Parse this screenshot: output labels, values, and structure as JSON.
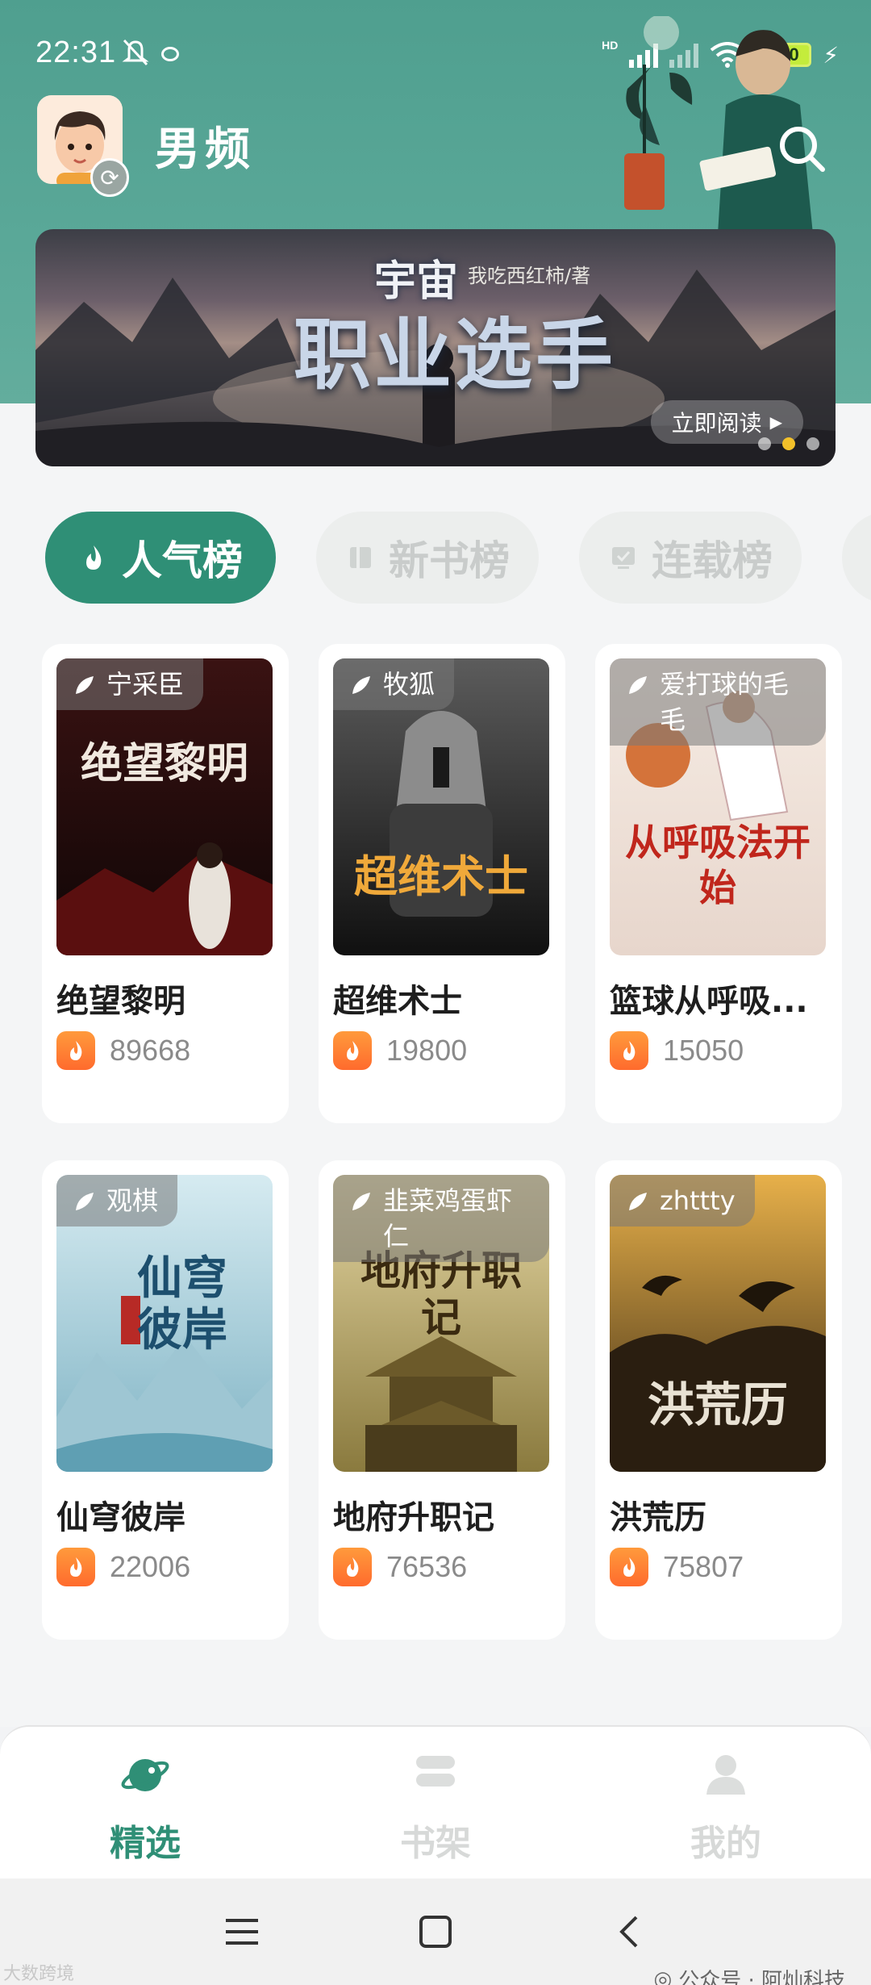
{
  "status_bar": {
    "time": "22:31",
    "battery": "100"
  },
  "header": {
    "channel": "男频"
  },
  "banner": {
    "title_small": "宇宙",
    "title": "职业选手",
    "author": "我吃西红柿/著",
    "read_label": "立即阅读",
    "pages": 3,
    "active_page": 2
  },
  "tabs": [
    {
      "label": "人气榜",
      "active": true,
      "icon": "flame-icon"
    },
    {
      "label": "新书榜",
      "active": false,
      "icon": "book-icon"
    },
    {
      "label": "连载榜",
      "active": false,
      "icon": "serial-icon"
    }
  ],
  "books": [
    {
      "author": "宁采臣",
      "title": "绝望黎明",
      "heat": "89668",
      "cover_title": "绝望黎明",
      "colors": [
        "#3a1212",
        "#0f0606"
      ]
    },
    {
      "author": "牧狐",
      "title": "超维术士",
      "heat": "19800",
      "cover_title": "超维术士",
      "colors": [
        "#5c5c5c",
        "#101010"
      ]
    },
    {
      "author": "爱打球的毛毛",
      "title": "篮球从呼吸...",
      "heat": "15050",
      "cover_title": "从呼吸法开始",
      "colors": [
        "#f6ece4",
        "#e7d6cc"
      ]
    },
    {
      "author": "观棋",
      "title": "仙穹彼岸",
      "heat": "22006",
      "cover_title": "仙穹彼岸",
      "colors": [
        "#d6ebf1",
        "#7fb3c4"
      ]
    },
    {
      "author": "韭菜鸡蛋虾仁",
      "title": "地府升职记",
      "heat": "76536",
      "cover_title": "地府升职记",
      "colors": [
        "#e4d6a2",
        "#8a7a3e"
      ]
    },
    {
      "author": "zhttty",
      "title": "洪荒历",
      "heat": "75807",
      "cover_title": "洪荒历",
      "colors": [
        "#e7b04a",
        "#3a2a14"
      ]
    }
  ],
  "bottom_nav": [
    {
      "label": "精选",
      "active": true,
      "icon": "planet-icon"
    },
    {
      "label": "书架",
      "active": false,
      "icon": "bookshelf-icon"
    },
    {
      "label": "我的",
      "active": false,
      "icon": "user-icon"
    }
  ],
  "watermark": {
    "text": "公众号 · 阿灿科技",
    "left": "大数跨境"
  },
  "colors": {
    "accent": "#2f8f76",
    "header": "#5aa898",
    "heat": "#ff7a32"
  }
}
